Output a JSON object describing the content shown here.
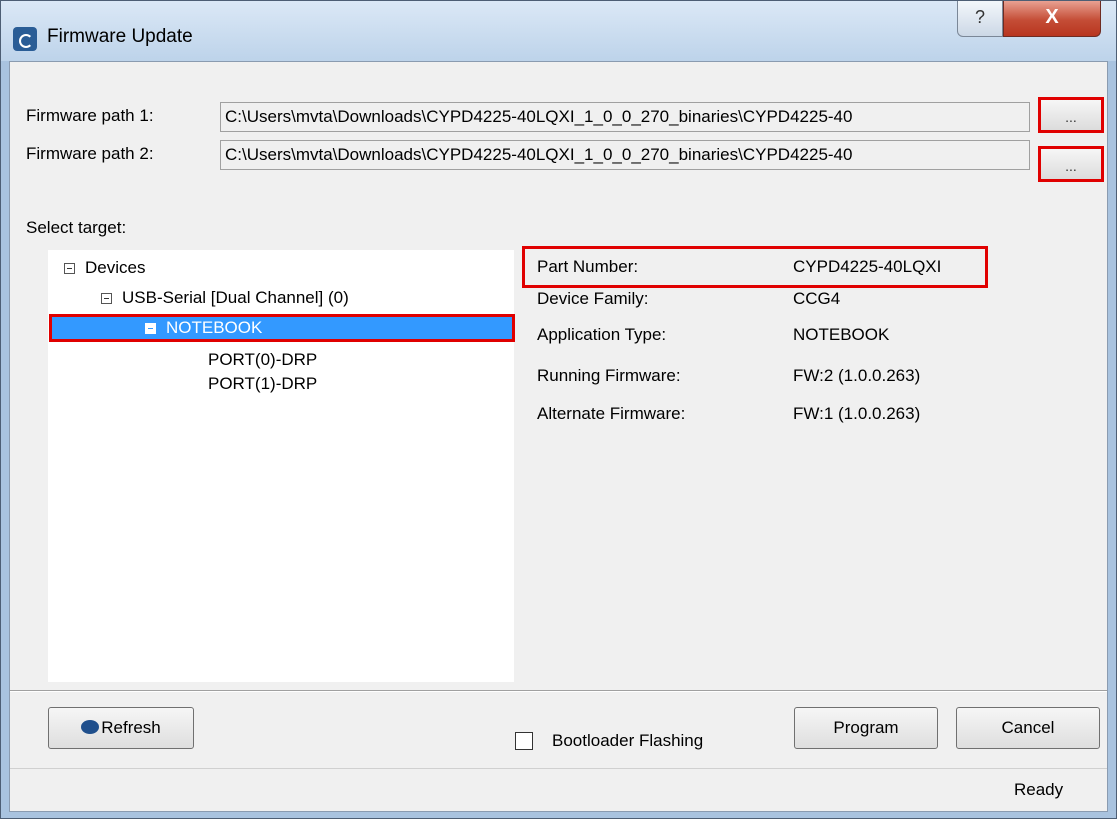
{
  "window": {
    "title": "Firmware Update",
    "help_glyph": "?",
    "close_glyph": "X"
  },
  "paths": {
    "label1": "Firmware path 1:",
    "value1": "C:\\Users\\mvta\\Downloads\\CYPD4225-40LQXI_1_0_0_270_binaries\\CYPD4225-40",
    "label2": "Firmware path 2:",
    "value2": "C:\\Users\\mvta\\Downloads\\CYPD4225-40LQXI_1_0_0_270_binaries\\CYPD4225-40",
    "browse_label": "..."
  },
  "target": {
    "label": "Select target:",
    "tree": {
      "root": "Devices",
      "adapter": "USB-Serial [Dual Channel] (0)",
      "device": "NOTEBOOK",
      "port0": "PORT(0)-DRP",
      "port1": "PORT(1)-DRP"
    }
  },
  "info": {
    "rows": [
      {
        "label": "Part Number:",
        "value": "CYPD4225-40LQXI"
      },
      {
        "label": "Device Family:",
        "value": "CCG4"
      },
      {
        "label": "Application Type:",
        "value": "NOTEBOOK"
      },
      {
        "label": "Running Firmware:",
        "value": "FW:2 (1.0.0.263)"
      },
      {
        "label": "Alternate Firmware:",
        "value": "FW:1 (1.0.0.263)"
      }
    ]
  },
  "buttons": {
    "refresh": "Refresh",
    "bootloader": "Bootloader Flashing",
    "bootloader_checked": false,
    "program": "Program",
    "cancel": "Cancel"
  },
  "status": {
    "text": "Ready"
  },
  "colors": {
    "selection": "#3399ff",
    "highlight_border": "#e00000",
    "title_gradient_top": "#dbe8f6",
    "close_button": "#c44d36"
  }
}
